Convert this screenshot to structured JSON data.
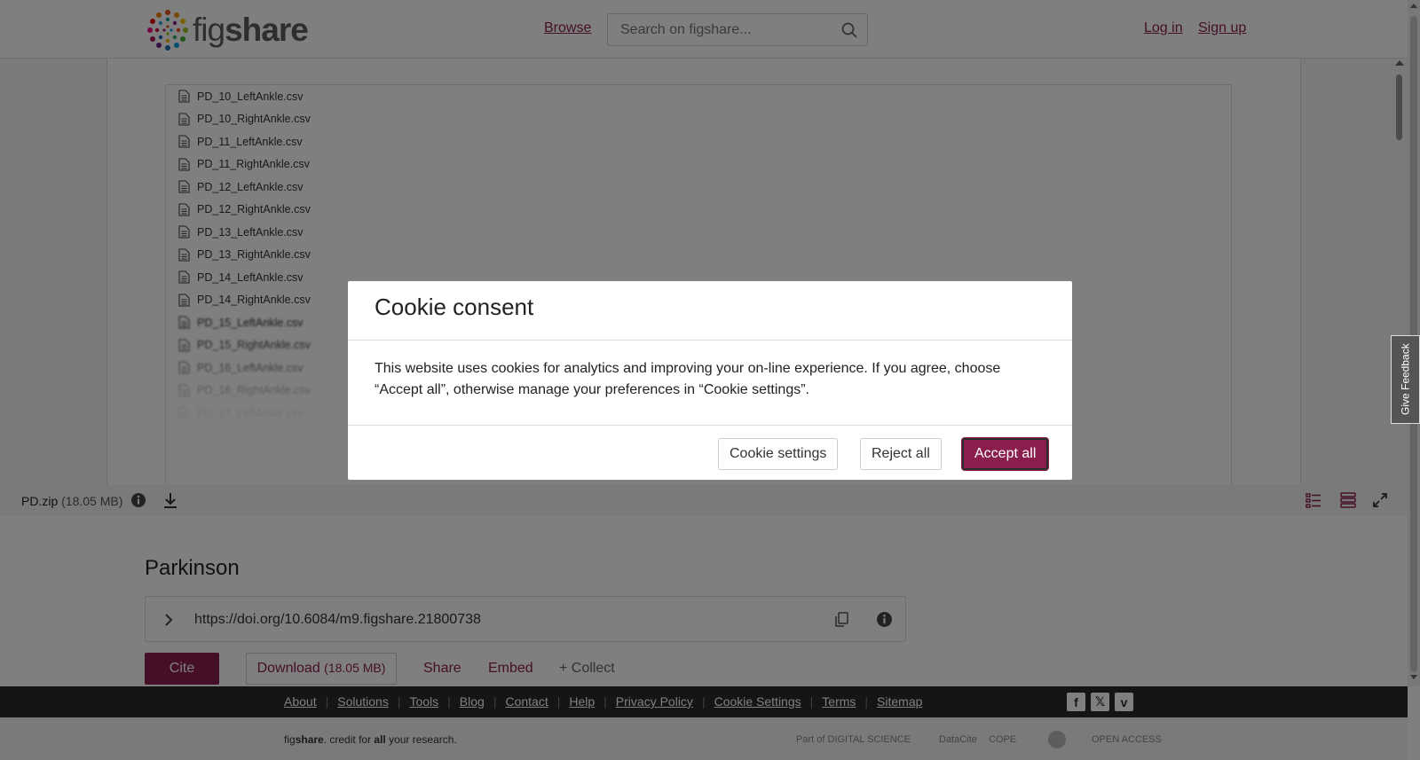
{
  "header": {
    "logo_text_a": "fig",
    "logo_text_b": "share",
    "browse": "Browse",
    "search_placeholder": "Search on figshare...",
    "login": "Log in",
    "signup": "Sign up"
  },
  "viewer": {
    "files": [
      "PD_10_LeftAnkle.csv",
      "PD_10_RightAnkle.csv",
      "PD_11_LeftAnkle.csv",
      "PD_11_RightAnkle.csv",
      "PD_12_LeftAnkle.csv",
      "PD_12_RightAnkle.csv",
      "PD_13_LeftAnkle.csv",
      "PD_13_RightAnkle.csv",
      "PD_14_LeftAnkle.csv",
      "PD_14_RightAnkle.csv",
      "PD_15_LeftAnkle.csv",
      "PD_15_RightAnkle.csv",
      "PD_16_LeftAnkle.csv",
      "PD_16_RightAnkle.csv",
      "PD_17_LeftAnkle.csv"
    ],
    "file_name": "PD.zip",
    "file_size": "(18.05 MB)"
  },
  "item": {
    "title": "Parkinson",
    "doi": "https://doi.org/10.6084/m9.figshare.21800738",
    "cite": "Cite",
    "download": "Download",
    "download_size": "(18.05 MB)",
    "share": "Share",
    "embed": "Embed",
    "collect": "+ Collect"
  },
  "footer": {
    "links": [
      "About",
      "Solutions",
      "Tools",
      "Blog",
      "Contact",
      "Help",
      "Privacy Policy",
      "Cookie Settings",
      "Terms",
      "Sitemap"
    ],
    "credit_a": "fig",
    "credit_b": "share",
    "credit_c": ". credit for ",
    "credit_d": "all",
    "credit_e": " your research.",
    "partner_digital_science": "Part of DIGITAL SCIENCE",
    "partner_datacite": "DataCite",
    "partner_cope": "COPE",
    "partner_open_access": "OPEN ACCESS"
  },
  "feedback": "Give Feedback",
  "modal": {
    "title": "Cookie consent",
    "body": "This website uses cookies for analytics and improving your on-line experience. If you agree, choose “Accept all”, otherwise manage your preferences in “Cookie settings”.",
    "settings": "Cookie settings",
    "reject": "Reject all",
    "accept": "Accept all"
  },
  "colors": {
    "brand": "#8a1e4e",
    "footer_dark": "#2b2b2b"
  }
}
